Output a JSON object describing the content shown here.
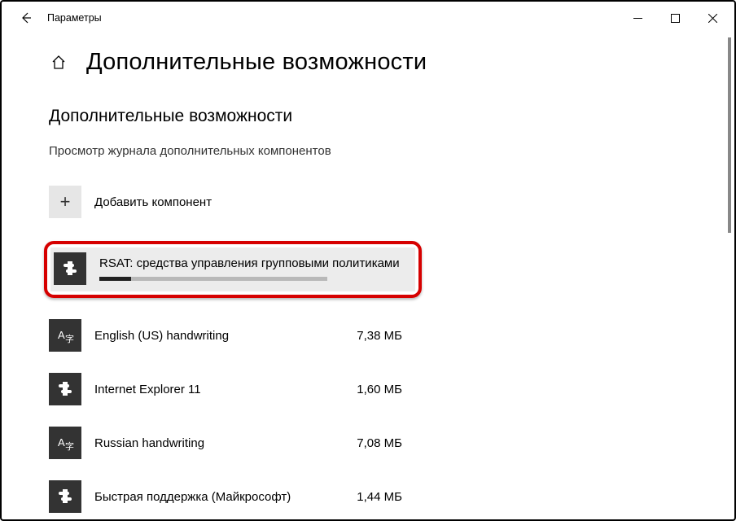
{
  "window": {
    "title": "Параметры"
  },
  "page": {
    "title": "Дополнительные возможности",
    "section_title": "Дополнительные возможности",
    "subtitle": "Просмотр журнала дополнительных компонентов",
    "add_label": "Добавить компонент"
  },
  "features": {
    "installing": {
      "name": "RSAT: средства управления групповыми политиками",
      "progress_pct": 14
    },
    "list": [
      {
        "name": "English (US) handwriting",
        "size": "7,38 МБ",
        "icon": "language"
      },
      {
        "name": "Internet Explorer 11",
        "size": "1,60 МБ",
        "icon": "puzzle"
      },
      {
        "name": "Russian handwriting",
        "size": "7,08 МБ",
        "icon": "language"
      },
      {
        "name": "Быстрая поддержка (Майкрософт)",
        "size": "1,44 МБ",
        "icon": "puzzle"
      }
    ]
  }
}
